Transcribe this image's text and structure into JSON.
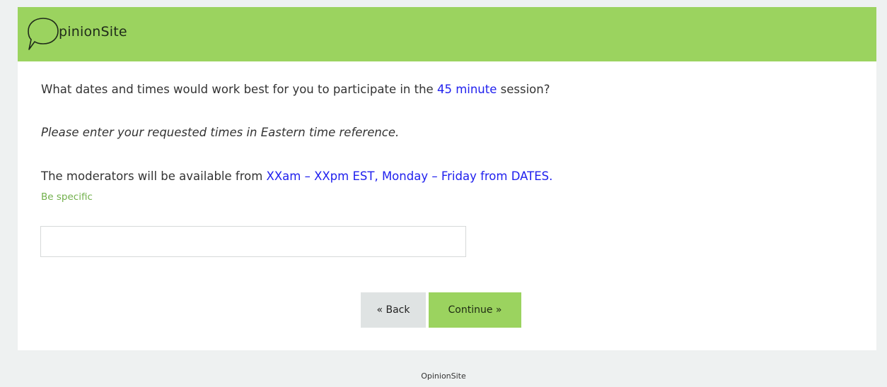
{
  "header": {
    "logo_text": "pinionSite"
  },
  "question": {
    "line1_prefix": "What dates and times would work best for you to participate in the ",
    "line1_highlight": "45 minute",
    "line1_suffix": " session?",
    "instruction": "Please enter your requested times in Eastern time reference.",
    "availability_prefix": "The moderators will be available from ",
    "availability_highlight": "XXam – XXpm EST, Monday – Friday from DATES.",
    "hint": "Be specific"
  },
  "answer": {
    "value": "",
    "placeholder": ""
  },
  "buttons": {
    "back_label": "« Back",
    "continue_label": "Continue »"
  },
  "footer": {
    "text": "OpinionSite"
  },
  "colors": {
    "brand_green": "#9bd35f",
    "accent_blue": "#2020ee",
    "hint_green": "#72b04c"
  }
}
